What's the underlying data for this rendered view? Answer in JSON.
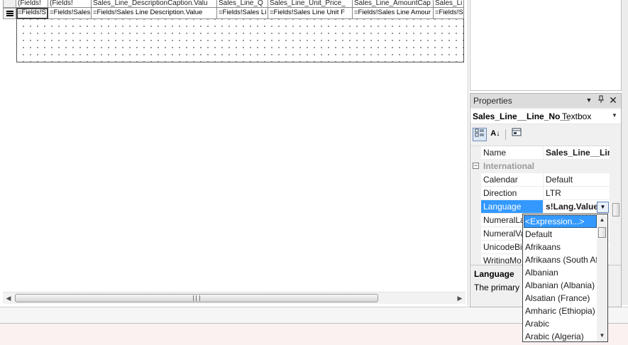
{
  "designer": {
    "header_cells": [
      "(Fields!",
      "(Fields!",
      "Sales_Line_DescriptionCaption.Valu",
      "Sales_Line_Q",
      "Sales_Line_Unit_Price_",
      "Sales_Line_AmountCap",
      "Sales_Li"
    ],
    "detail_cells": [
      "=Fields!S",
      "=Fields!Sales",
      "=Fields!Sales Line Description.Value",
      "=Fields!Sales Li",
      "=Fields!Sales Line Unit F",
      "=Fields!Sales Line Amour",
      "=Fields!S"
    ]
  },
  "properties": {
    "title": "Properties",
    "object_name": "Sales_Line__Line_No__",
    "object_type": "Textbox",
    "rows": [
      {
        "name": "Name",
        "value": "Sales_Line__Line"
      },
      {
        "category": "International"
      },
      {
        "name": "Calendar",
        "value": "Default"
      },
      {
        "name": "Direction",
        "value": "LTR"
      },
      {
        "name": "Language",
        "value": "s!Lang.Value)"
      },
      {
        "name": "NumeralLa",
        "value": ""
      },
      {
        "name": "NumeralVa",
        "value": ""
      },
      {
        "name": "UnicodeBi",
        "value": ""
      },
      {
        "name": "WritingMo",
        "value": ""
      }
    ],
    "description_title": "Language",
    "description_text": "The primary"
  },
  "language_list": {
    "options": [
      "<Expression...>",
      "Default",
      "Afrikaans",
      "Afrikaans (South Af",
      "Albanian",
      "Albanian (Albania)",
      "Alsatian (France)",
      "Amharic (Ethiopia)",
      "Arabic",
      "Arabic (Algeria)"
    ],
    "selected_index": 0
  },
  "icons": [
    "menu-icon",
    "categorized-icon",
    "alphabetical-icon",
    "property-pages-icon",
    "pin-icon",
    "close-icon",
    "chevron-down-icon",
    "expander-minus-icon"
  ],
  "colors": {
    "selection": "#3399ff",
    "panel": "#f0f0f0",
    "title_bar": "#dcdcdc"
  }
}
